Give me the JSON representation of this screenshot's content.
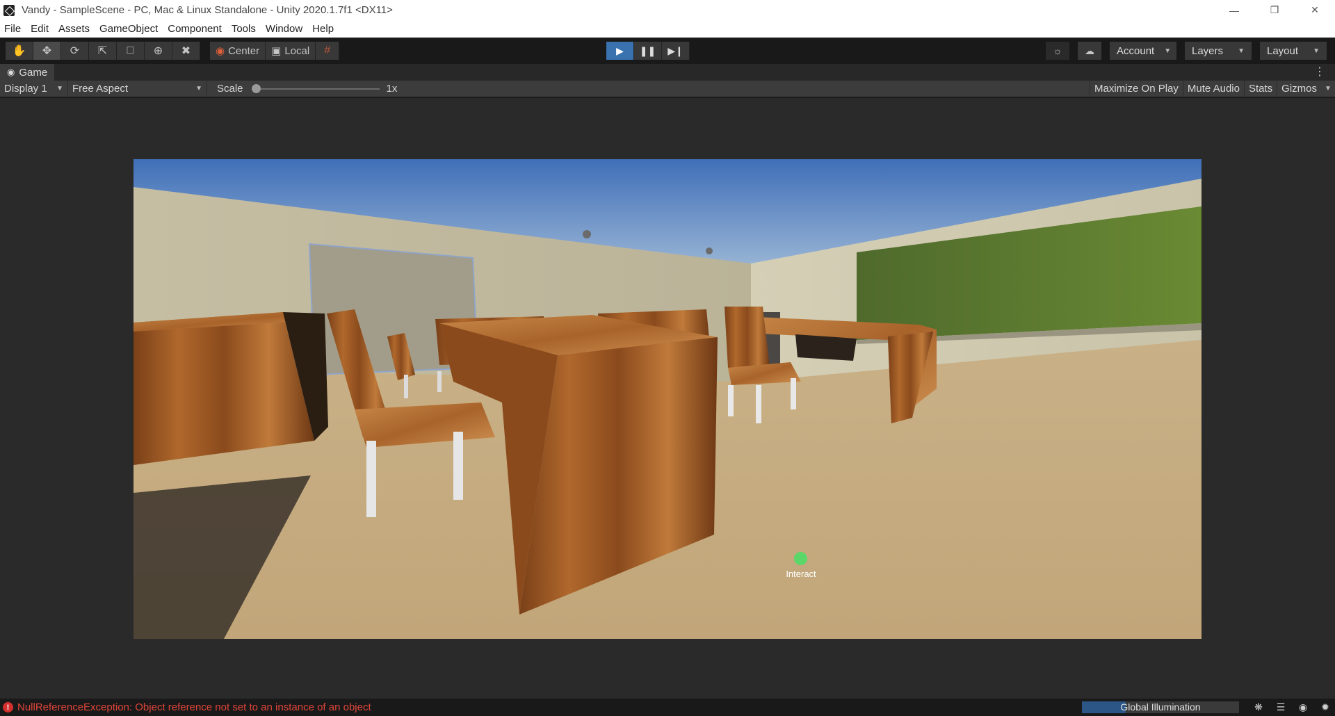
{
  "window": {
    "title": "Vandy - SampleScene - PC, Mac & Linux Standalone - Unity 2020.1.7f1 <DX11>"
  },
  "menu": [
    "File",
    "Edit",
    "Assets",
    "GameObject",
    "Component",
    "Tools",
    "Window",
    "Help"
  ],
  "toolbar": {
    "pivot_label": "Center",
    "space_label": "Local",
    "account_label": "Account",
    "layers_label": "Layers",
    "layout_label": "Layout"
  },
  "game_tab": {
    "label": "Game"
  },
  "game_bar": {
    "display": "Display 1",
    "aspect": "Free Aspect",
    "scale_label": "Scale",
    "scale_value": "1x",
    "maximize_label": "Maximize On Play",
    "mute_label": "Mute Audio",
    "stats_label": "Stats",
    "gizmos_label": "Gizmos"
  },
  "game_view": {
    "interact_label": "Interact"
  },
  "status": {
    "error_text": "NullReferenceException: Object reference not set to an instance of an object",
    "gi_label": "Global Illumination",
    "gi_progress": 0.28
  },
  "colors": {
    "accent_play": "#3a72b0",
    "error": "#e0453a",
    "crosshair": "#5ad768"
  }
}
